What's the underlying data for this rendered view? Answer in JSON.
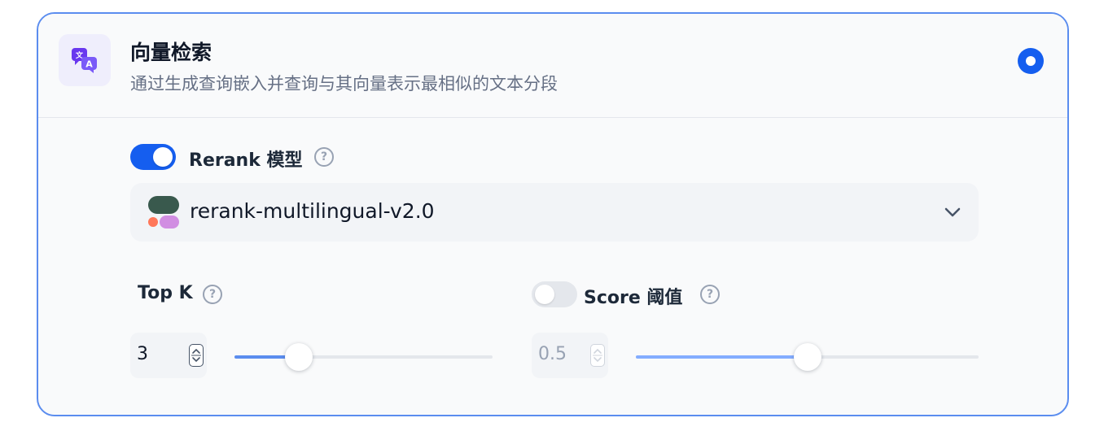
{
  "card": {
    "title": "向量检索",
    "subtitle": "通过生成查询嵌入并查询与其向量表示最相似的文本分段",
    "icon": "translate-icon",
    "selected": true
  },
  "rerank": {
    "enabled": true,
    "label": "Rerank 模型",
    "model_value": "rerank-multilingual-v2.0",
    "model_icon": "cohere-logo",
    "dropdown_icon": "chevron-down-icon"
  },
  "top_k": {
    "label": "Top K",
    "value": "3",
    "slider_fraction": 0.25
  },
  "score_threshold": {
    "enabled": false,
    "label": "Score 阈值",
    "value": "0.5",
    "slider_fraction": 0.5
  },
  "colors": {
    "accent": "#155eef",
    "border": "#5b8def",
    "icon_purple": "#6938ef",
    "slider_fill": "#5b8def",
    "slider_fill_disabled": "#84adff"
  }
}
